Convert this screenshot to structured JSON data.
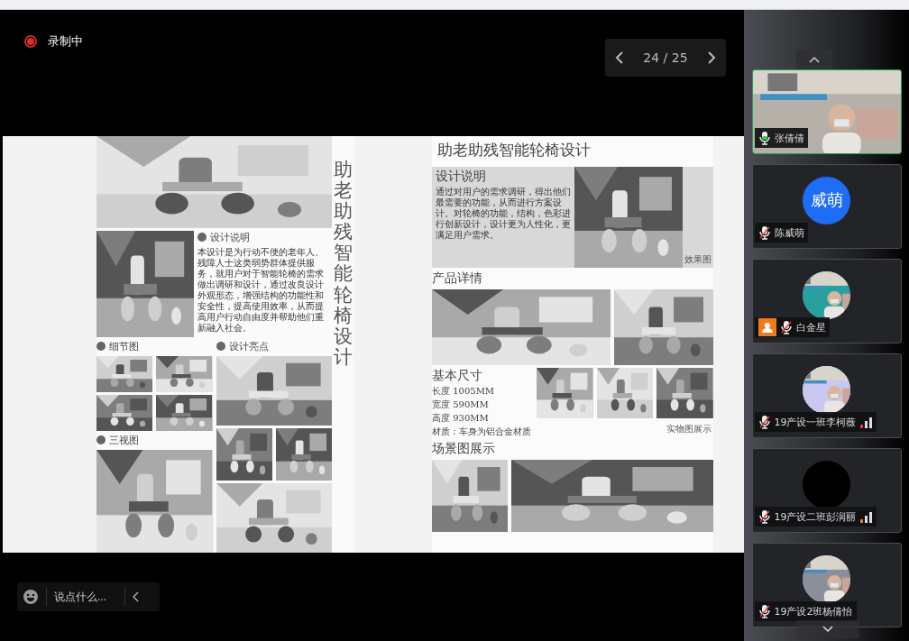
{
  "recording": {
    "label": "录制中",
    "on": true
  },
  "pager": {
    "text": "24 / 25"
  },
  "slide": {
    "left_poster": {
      "title": "助老助残智能轮椅设计",
      "sections": [
        {
          "heading": "设计说明",
          "text": "本设计是为行动不便的老年人、残障人士这类弱势群体提供服务，就用户对于智能轮椅的需求做出调研和设计，通过改良设计外观形态，增强结构的功能性和安全性，提高使用效率，从而提高用户行动自由度并帮助他们重新融入社会。"
        },
        {
          "heading": "细节图"
        },
        {
          "heading": "设计亮点"
        },
        {
          "heading": "三视图"
        }
      ]
    },
    "right_poster": {
      "title": "助老助残智能轮椅设计",
      "intro_heading": "设计说明",
      "intro_text": "通过对用户的需求调研，得出他们最需要的功能，从而进行方案设计。对轮椅的功能，结构，色彩进行创新设计，设计更为人性化，更满足用户需求。",
      "render_caption": "效果图",
      "details_heading": "产品详情",
      "size_heading": "基本尺寸",
      "sizes": [
        "长度 1005MM",
        "宽度 590MM",
        "高度 930MM",
        "材质：车身为铝合金材质"
      ],
      "real_caption": "实物图展示",
      "scene_heading": "场景图展示"
    }
  },
  "chat": {
    "placeholder": "说点什么..."
  },
  "participants": [
    {
      "name": "张倩倩",
      "kind": "video",
      "muted": false,
      "speaking": true
    },
    {
      "name": "陈威萌",
      "kind": "initials",
      "initials": "威萌",
      "muted": true,
      "speaking": false
    },
    {
      "name": "白金星",
      "muted": true,
      "speaking": false,
      "host_badge": true
    },
    {
      "name": "19产设一班李柯薇",
      "muted": true,
      "speaking": false,
      "color": "#e53935"
    },
    {
      "name": "19产设二班彭润丽",
      "kind": "blank",
      "muted": true,
      "speaking": false,
      "color": "#f57c00"
    },
    {
      "name": "19产设2班杨倩怡",
      "muted": true,
      "speaking": false
    }
  ]
}
